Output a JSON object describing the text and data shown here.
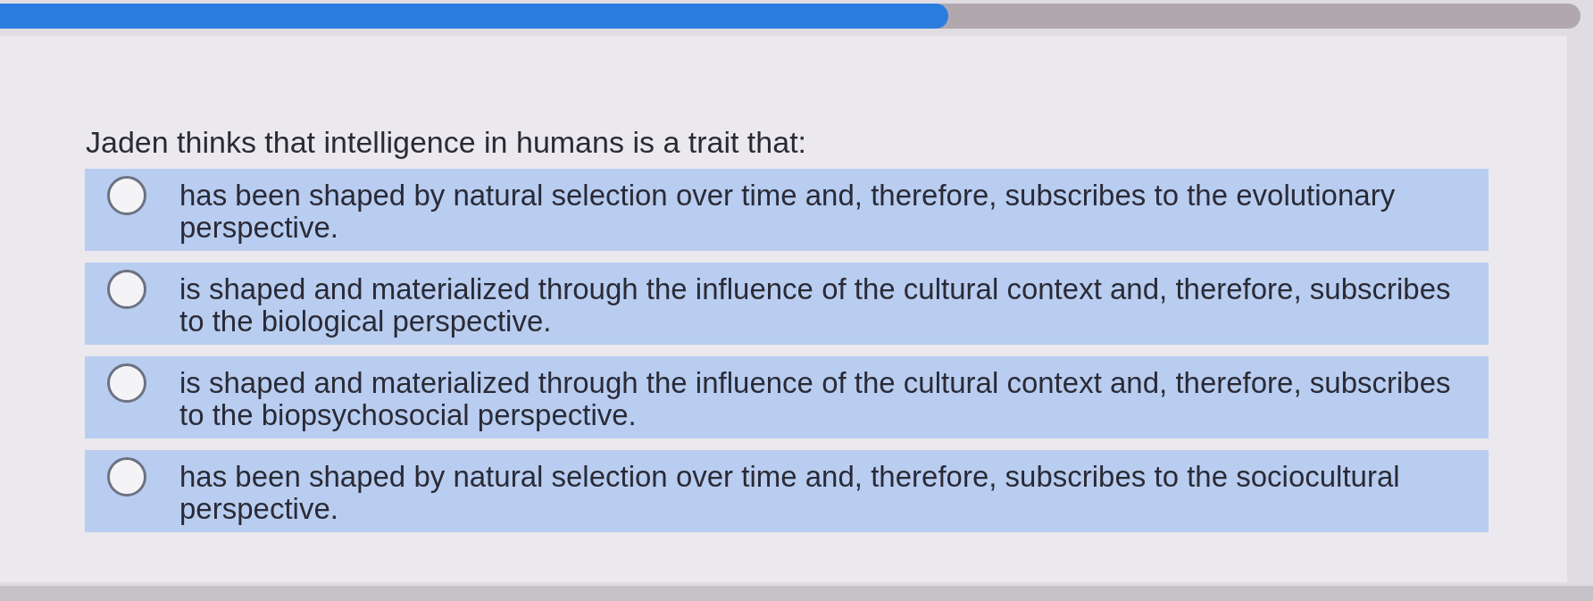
{
  "progress": {
    "level": 0.6
  },
  "question": {
    "text": "Jaden thinks that intelligence in humans is a trait that:"
  },
  "options": [
    {
      "text": "has been shaped by natural selection over time and, therefore, subscribes to the evolutionary perspective.",
      "selected": false
    },
    {
      "text": "is shaped and materialized through the influence of the cultural context and, therefore, subscribes to the biological perspective.",
      "selected": false
    },
    {
      "text": "is shaped and materialized through the influence of the cultural context and, therefore, subscribes to the biopsychosocial perspective.",
      "selected": false
    },
    {
      "text": "has been shaped by natural selection over time and, therefore, subscribes to the sociocultural perspective.",
      "selected": false
    }
  ]
}
